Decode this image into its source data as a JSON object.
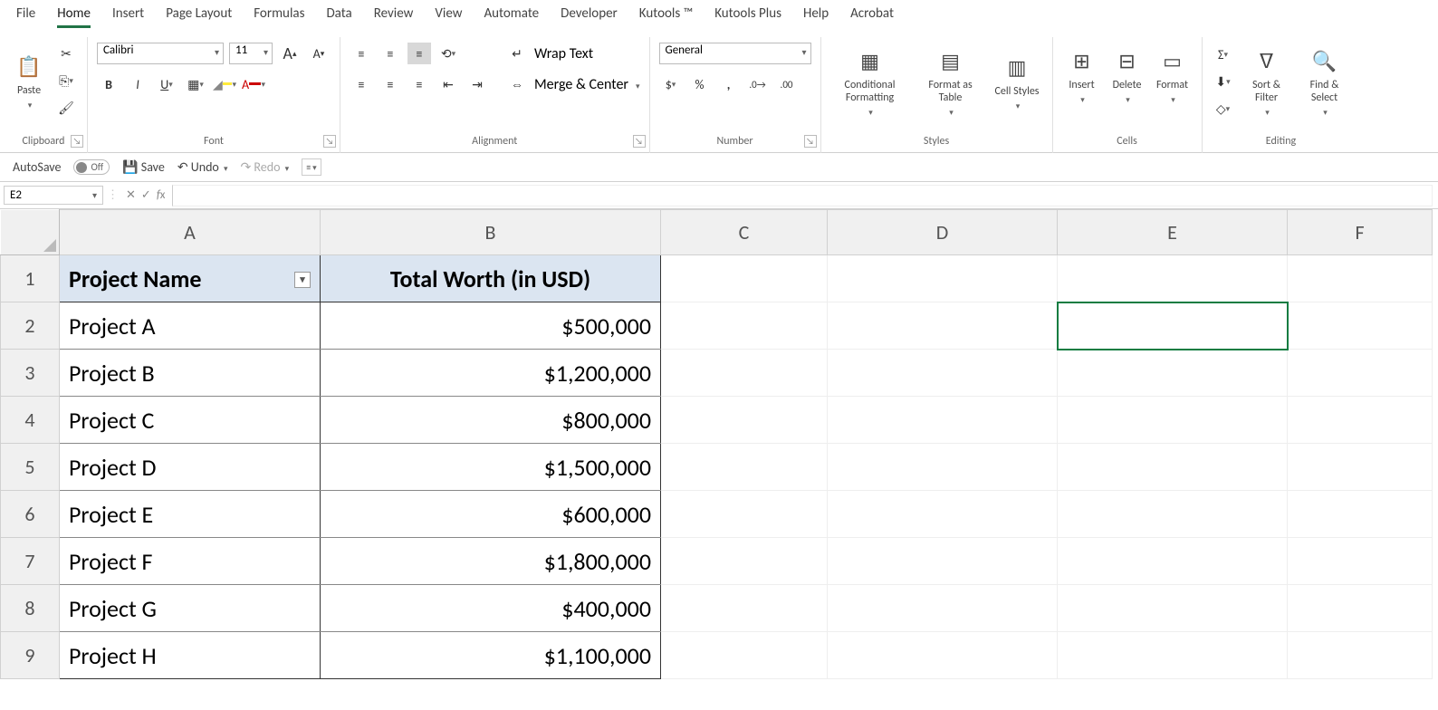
{
  "menu": {
    "items": [
      "File",
      "Home",
      "Insert",
      "Page Layout",
      "Formulas",
      "Data",
      "Review",
      "View",
      "Automate",
      "Developer",
      "Kutools ™",
      "Kutools Plus",
      "Help",
      "Acrobat"
    ],
    "active": "Home"
  },
  "ribbon": {
    "clipboard": {
      "paste": "Paste",
      "label": "Clipboard"
    },
    "font": {
      "name": "Calibri",
      "size": "11",
      "label": "Font"
    },
    "alignment": {
      "wrap": "Wrap Text",
      "merge": "Merge & Center",
      "label": "Alignment"
    },
    "number": {
      "format": "General",
      "label": "Number"
    },
    "styles": {
      "cond": "Conditional Formatting",
      "table": "Format as Table",
      "cell": "Cell Styles",
      "label": "Styles"
    },
    "cells": {
      "insert": "Insert",
      "delete": "Delete",
      "format": "Format",
      "label": "Cells"
    },
    "editing": {
      "sort": "Sort & Filter",
      "find": "Find & Select",
      "label": "Editing"
    }
  },
  "qat": {
    "autosave": "AutoSave",
    "off": "Off",
    "save": "Save",
    "undo": "Undo",
    "redo": "Redo"
  },
  "fx": {
    "namebox": "E2"
  },
  "grid": {
    "columns": [
      "A",
      "B",
      "C",
      "D",
      "E",
      "F"
    ],
    "rows": [
      "1",
      "2",
      "3",
      "4",
      "5",
      "6",
      "7",
      "8",
      "9"
    ],
    "headers": {
      "a": "Project Name",
      "b": "Total Worth (in USD)"
    },
    "data": [
      {
        "a": "Project A",
        "b": "$500,000"
      },
      {
        "a": "Project B",
        "b": "$1,200,000"
      },
      {
        "a": "Project C",
        "b": "$800,000"
      },
      {
        "a": "Project D",
        "b": "$1,500,000"
      },
      {
        "a": "Project E",
        "b": "$600,000"
      },
      {
        "a": "Project F",
        "b": "$1,800,000"
      },
      {
        "a": "Project G",
        "b": "$400,000"
      },
      {
        "a": "Project H",
        "b": "$1,100,000"
      }
    ]
  }
}
